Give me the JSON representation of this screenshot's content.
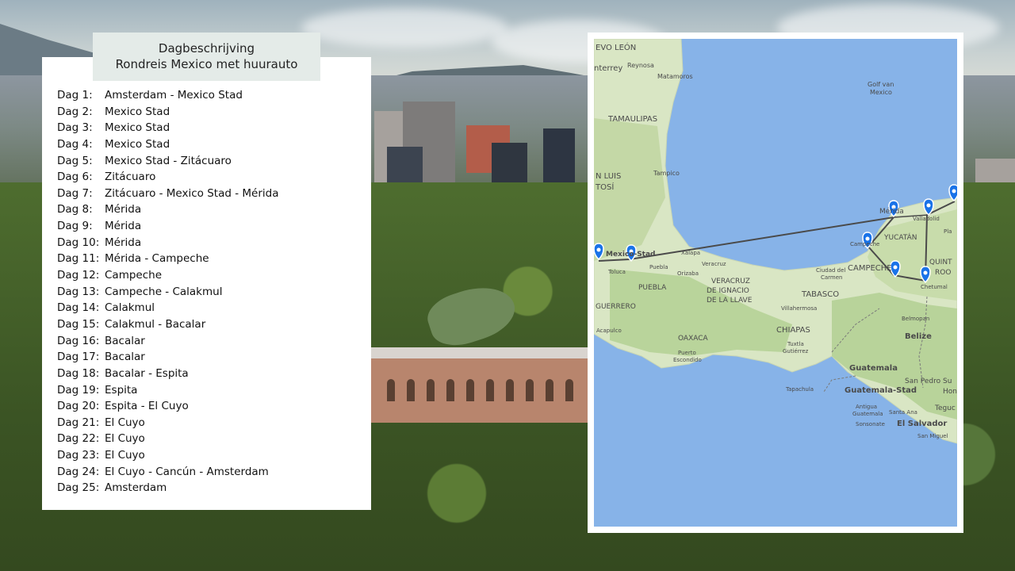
{
  "itinerary": {
    "title_line1": "Dagbeschrijving",
    "title_line2": "Rondreis Mexico met huurauto",
    "days": [
      {
        "label": "Dag 1:",
        "desc": "Amsterdam - Mexico Stad"
      },
      {
        "label": "Dag 2:",
        "desc": "Mexico Stad"
      },
      {
        "label": "Dag 3:",
        "desc": "Mexico Stad"
      },
      {
        "label": "Dag 4:",
        "desc": "Mexico Stad"
      },
      {
        "label": "Dag 5:",
        "desc": "Mexico Stad - Zitácuaro"
      },
      {
        "label": "Dag 6:",
        "desc": "Zitácuaro"
      },
      {
        "label": "Dag 7:",
        "desc": "Zitácuaro - Mexico Stad - Mérida"
      },
      {
        "label": "Dag 8:",
        "desc": "Mérida"
      },
      {
        "label": "Dag 9:",
        "desc": "Mérida"
      },
      {
        "label": "Dag 10:",
        "desc": "Mérida"
      },
      {
        "label": "Dag 11:",
        "desc": "Mérida - Campeche"
      },
      {
        "label": "Dag 12:",
        "desc": "Campeche"
      },
      {
        "label": "Dag 13:",
        "desc": "Campeche - Calakmul"
      },
      {
        "label": "Dag 14:",
        "desc": "Calakmul"
      },
      {
        "label": "Dag 15:",
        "desc": "Calakmul - Bacalar"
      },
      {
        "label": "Dag 16:",
        "desc": "Bacalar"
      },
      {
        "label": "Dag 17:",
        "desc": "Bacalar"
      },
      {
        "label": "Dag 18:",
        "desc": "Bacalar - Espita"
      },
      {
        "label": "Dag 19:",
        "desc": "Espita"
      },
      {
        "label": "Dag 20:",
        "desc": "Espita - El Cuyo"
      },
      {
        "label": "Dag 21:",
        "desc": "El Cuyo"
      },
      {
        "label": "Dag 22:",
        "desc": "El Cuyo"
      },
      {
        "label": "Dag 23:",
        "desc": "El Cuyo"
      },
      {
        "label": "Dag 24:",
        "desc": "El Cuyo - Cancún - Amsterdam"
      },
      {
        "label": "Dag 25:",
        "desc": "Amsterdam"
      }
    ]
  },
  "map": {
    "colors": {
      "water": "#87b3e8",
      "land": "#d9e6c4",
      "forest": "#b8d39a",
      "route": "#4a4a4a",
      "pin": "#1a73e8"
    },
    "labels": {
      "nuevo_leon": "EVO LEÓN",
      "reynosa": "Reynosa",
      "monterrey": "nterrey",
      "matamoros": "Matamoros",
      "golf": "Golf van",
      "golf2": "Mexico",
      "tamaulipas": "TAMAULIPAS",
      "san_luis": "N LUIS",
      "tosi": "TOSÍ",
      "tampico": "Tampico",
      "merida": "Mérida",
      "valladolid": "Valladolid",
      "yucatan": "YUCATÁN",
      "campeche_city": "Campeche",
      "campeche": "CAMPECHE",
      "quintana": "QUINT",
      "roo": "ROO",
      "cd_carmen": "Ciudad del",
      "carmen": "Carmen",
      "chetumal": "Chetumal",
      "mexico_stad": "Mexico-Stad",
      "xalapa": "Xalapa",
      "toluca": "Toluca",
      "puebla_city": "Puebla",
      "veracruz_city": "Veracruz",
      "orizaba": "Orizaba",
      "puebla": "PUEBLA",
      "veracruz": "VERACRUZ",
      "ignacio": "DE IGNACIO",
      "llave": "DE LA LLAVE",
      "tabasco": "TABASCO",
      "villahermosa": "Villahermosa",
      "guerrero": "GUERRERO",
      "acapulco": "Acapulco",
      "oaxaca": "OAXACA",
      "puerto": "Puerto",
      "escondido": "Escondido",
      "chiapas": "CHIAPAS",
      "tuxtla": "Tuxtla",
      "gutierrez": "Gutiérrez",
      "belmopan": "Belmopan",
      "belize": "Belize",
      "guatemala": "Guatemala",
      "tapachula": "Tapachula",
      "guatemala_stad": "Guatemala-Stad",
      "antigua": "Antigua",
      "antigua2": "Guatemala",
      "santa_ana": "Santa Ana",
      "sonsonate": "Sonsonate",
      "el_salvador": "El Salvador",
      "san_miguel": "San Miguel",
      "san_pedro": "San Pedro Su",
      "hon": "Hon",
      "tegu": "Teguc",
      "pla": "Pla"
    }
  }
}
